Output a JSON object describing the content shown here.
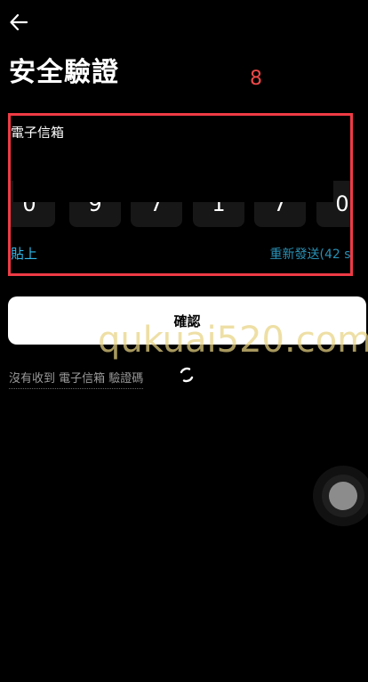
{
  "header": {
    "back_icon": "arrow-left-icon",
    "title": "安全驗證"
  },
  "annotation": {
    "number": "8",
    "color": "#ef3b45"
  },
  "verification": {
    "field_label": "電子信箱",
    "code_digits": [
      "0",
      "9",
      "7",
      "1",
      "7",
      "0"
    ],
    "paste_label": "貼上",
    "resend_label": "重新發送(42 s)",
    "accent_color": "#31b8e8"
  },
  "actions": {
    "confirm_label": "確認",
    "no_code_label": "沒有收到 電子信箱 驗證碼"
  },
  "watermark": {
    "text": "qukuai520.com"
  },
  "floating_button": {
    "icon": "assistive-touch-icon"
  }
}
